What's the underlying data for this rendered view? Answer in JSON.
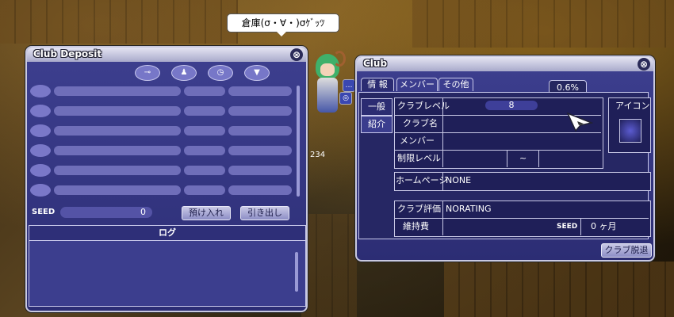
{
  "speech_bubble": "倉庫(σ・∀・)σｹﾞｯﾂ",
  "damage_number": "234",
  "club_deposit": {
    "title": "Club Deposit",
    "close": "⊗",
    "toolbar_icons": [
      "key-icon",
      "person-icon",
      "clock-icon",
      "down-arrow-icon"
    ],
    "seed_label": "SEED",
    "seed_value": "0",
    "deposit_button": "預け入れ",
    "withdraw_button": "引き出し",
    "log_header": "ログ"
  },
  "club": {
    "title": "Club",
    "close": "⊗",
    "tabs": [
      "情 報",
      "メンバー",
      "その他"
    ],
    "percent_badge": "0.6%",
    "side_tabs": [
      "一般",
      "紹介"
    ],
    "fields": {
      "club_level_label": "クラブレベル",
      "club_level_value": "8",
      "club_name_label": "クラブ名",
      "member_label": "メンバー",
      "limit_level_label": "制限レベル",
      "limit_sep": "~",
      "homepage_label": "ホームページ",
      "homepage_value": "NONE",
      "rating_label": "クラブ評価",
      "rating_value": "NORATING",
      "upkeep_label": "維持費",
      "seed_label": "SEED",
      "upkeep_value": "0 ヶ月"
    },
    "icon_label": "アイコン",
    "leave_button": "クラブ脱退"
  }
}
